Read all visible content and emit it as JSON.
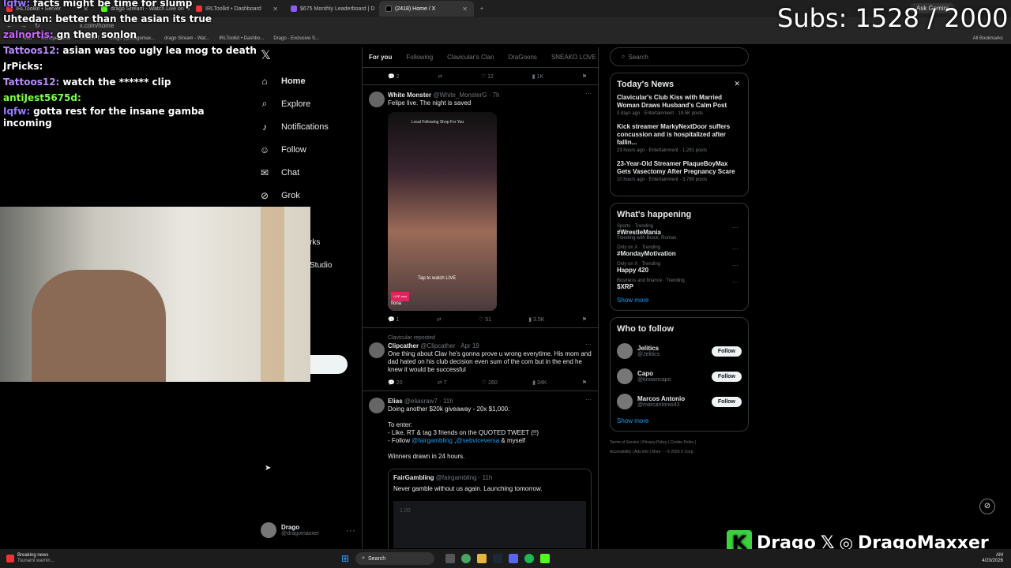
{
  "browser": {
    "tabs": [
      {
        "label": "IRLToolkit • Server"
      },
      {
        "label": "drago Stream - Watch Live on"
      },
      {
        "label": "IRLToolkit • Dashboard"
      },
      {
        "label": "$675 Monthly Leaderboard | D"
      },
      {
        "label": "(2418) Home / X"
      }
    ],
    "url": "x.com/home",
    "bookmarks": [
      "edu",
      "work/personal",
      "ChatGPT",
      "Drago (@dragomax...",
      "drago Stream - Wat...",
      "IRLToolkit • Dashbo...",
      "Drago - Exclusive S..."
    ],
    "all_bookmarks": "All Bookmarks",
    "ask_gemini": "Ask Gemini"
  },
  "stream": {
    "subs": "Subs: 1528 / 2000",
    "chat": [
      {
        "user": "Iqfw:",
        "color": "#9b7bff",
        "msg": "facts might be time for slump"
      },
      {
        "user": "Uhtedan:",
        "color": "#ffffff",
        "msg": "better than the asian its true"
      },
      {
        "user": "zalnortis:",
        "color": "#cc66ff",
        "msg": "gn then sonlon"
      },
      {
        "user": "Tattoos12:",
        "color": "#b98cff",
        "msg": "asian was too ugly lea mog to death"
      },
      {
        "user": "JrPicks:",
        "color": "#ffffff",
        "msg": ""
      },
      {
        "user": "Tattoos12:",
        "color": "#b98cff",
        "msg": "watch the ****** clip"
      },
      {
        "user": "antiJest5675d:",
        "color": "#7cff4d",
        "msg": ""
      },
      {
        "user": "Iqfw:",
        "color": "#9b7bff",
        "msg": "gotta rest for the insane gamba incoming"
      }
    ],
    "overlay_name1": "Drago",
    "overlay_name2": "DragoMaxxer"
  },
  "nav": {
    "items": [
      {
        "label": "Home",
        "icon": "home-icon",
        "glyph": "⌂"
      },
      {
        "label": "Explore",
        "icon": "search-icon",
        "glyph": "⌕"
      },
      {
        "label": "Notifications",
        "icon": "bell-icon",
        "glyph": "♪"
      },
      {
        "label": "Follow",
        "icon": "person-add-icon",
        "glyph": "☺"
      },
      {
        "label": "Chat",
        "icon": "chat-icon",
        "glyph": "✉"
      },
      {
        "label": "Grok",
        "icon": "grok-icon",
        "glyph": "⊘"
      }
    ],
    "partial_items": [
      "rks",
      "Studio"
    ],
    "account_name": "Drago",
    "account_handle": "@dragomaxxer"
  },
  "feed": {
    "tabs": [
      "For you",
      "Following",
      "Clavicular's Clan",
      "DraGoons",
      "SNEAKO LOVE SPEED"
    ],
    "top_actions": [
      "2",
      "",
      "12",
      "1K"
    ],
    "tweets": [
      {
        "name": "White Monster",
        "handle": "@White_MonsterG · 7h",
        "text": "Felipe live. The night is saved",
        "actions": [
          "1",
          "",
          "51",
          "3.5K"
        ],
        "media_tabs": "Local  Following  Shop  For You",
        "media_cta": "Tap to watch LIVE",
        "media_live": "LIVE now",
        "media_user": "fiona"
      },
      {
        "repost": "Clavicular reposted",
        "name": "Clipcather",
        "handle": "@Clipcather · Apr 19",
        "text": "One thing about Clav he's gonna prove u wrong everytime. His mom and dad hated on his club decision even sum of the com but in the end he knew it would be successful",
        "actions": [
          "20",
          "7",
          "260",
          "34K"
        ]
      },
      {
        "name": "Elias",
        "handle": "@eliasraw7 · 11h",
        "text": "Doing another $20k giveaway - 20x $1,000.",
        "enter": "To enter:",
        "rule1": "- Like, RT & tag 3 friends on the QUOTED TWEET (!!)",
        "rule2_prefix": "- Follow ",
        "rule2_link1": "@fairgambling",
        "rule2_link2": "@sebviceversa",
        "rule2_suffix": " & myself",
        "winners": "Winners drawn in 24 hours.",
        "quote_name": "FairGambling",
        "quote_handle": "@fairgambling · 11h",
        "quote_text": "Never gamble without us again. Launching tomorrow.",
        "quote_value": "1.00"
      }
    ]
  },
  "right": {
    "search_placeholder": "Search",
    "news_title": "Today's News",
    "news": [
      {
        "title": "Clavicular's Club Kiss with Married Woman Draws Husband's Calm Post",
        "meta": "3 days ago · Entertainment · 19.5K posts"
      },
      {
        "title": "Kick streamer MarkyNextDoor suffers concussion and is hospitalized after fallin...",
        "meta": "23 hours ago · Entertainment · 1,281 posts"
      },
      {
        "title": "23-Year-Old Streamer PlaqueBoyMax Gets Vasectomy After Pregnancy Scare",
        "meta": "10 hours ago · Entertainment · 3,780 posts"
      }
    ],
    "happening_title": "What's happening",
    "trends": [
      {
        "cat": "Sports · Trending",
        "name": "#WrestleMania",
        "sub": "Trending with Brock, Roman"
      },
      {
        "cat": "Only on X · Trending",
        "name": "#MondayMotivation",
        "sub": ""
      },
      {
        "cat": "Only on X · Trending",
        "name": "Happy 420",
        "sub": ""
      },
      {
        "cat": "Business and finance · Trending",
        "name": "$XRP",
        "sub": ""
      }
    ],
    "show_more": "Show more",
    "who_title": "Who to follow",
    "who": [
      {
        "name": "Jelitics",
        "handle": "@Jelitics"
      },
      {
        "name": "Capo",
        "handle": "@knowncapo"
      },
      {
        "name": "Marcos Antonio",
        "handle": "@marcantonio43"
      }
    ],
    "follow_label": "Follow",
    "footer1": "Terms of Service | Privacy Policy | Cookie Policy |",
    "footer2": "Accessibility | Ads info | More ··· © 2026 X Corp."
  },
  "taskbar": {
    "news_title": "Breaking news",
    "news_sub": "Tsunami warnin...",
    "search": "Search",
    "clock_time": "AM",
    "clock_date": "4/20/2026"
  }
}
